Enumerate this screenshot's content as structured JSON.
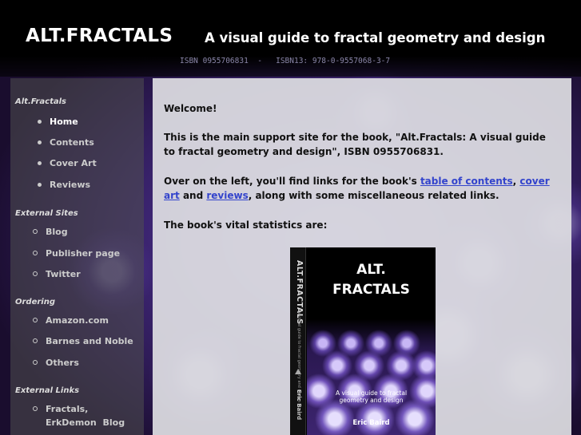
{
  "header": {
    "site_title": "ALT.FRACTALS",
    "tagline": "A visual guide to fractal geometry and design",
    "isbn_line": "ISBN 0955706831  -   ISBN13: 978-0-9557068-3-7"
  },
  "sidebar": {
    "sections": [
      {
        "heading": "Alt.Fractals",
        "items": [
          "Home",
          "Contents",
          "Cover Art",
          "Reviews"
        ]
      },
      {
        "heading": "External Sites",
        "items": [
          "Blog",
          "Publisher page",
          "Twitter"
        ]
      },
      {
        "heading": "Ordering",
        "items": [
          "Amazon.com",
          "Barnes and Noble",
          "Others"
        ]
      },
      {
        "heading": "External Links",
        "items": [
          "Fractals, ErkDemon Blog"
        ]
      }
    ]
  },
  "content": {
    "welcome": "Welcome!",
    "intro": "This is the main support site for the book, \"Alt.Fractals: A visual guide to fractal geometry and design\", ISBN 0955706831.",
    "links_para": {
      "part1": "Over on the left, you'll find links for the book's ",
      "link_toc": "table of contents",
      "part2": ", ",
      "link_cover": "cover art",
      "part3": " and ",
      "link_reviews": "reviews",
      "part4": ", along with some miscellaneous related links."
    },
    "stats_intro": "The book's vital statistics are:"
  },
  "cover": {
    "spine_title": "ALT.FRACTALS",
    "spine_subtitle": "a visual guide to fractal geometry and design",
    "spine_author": "Eric Baird",
    "front_title": "ALT.\nFRACTALS",
    "front_subtitle": "A visual guide to fractal\ngeometry and design",
    "front_author": "Eric Baird"
  },
  "colors": {
    "link": "#3344cc",
    "header_text": "#ffffff",
    "content_bg": "#dedee2"
  }
}
